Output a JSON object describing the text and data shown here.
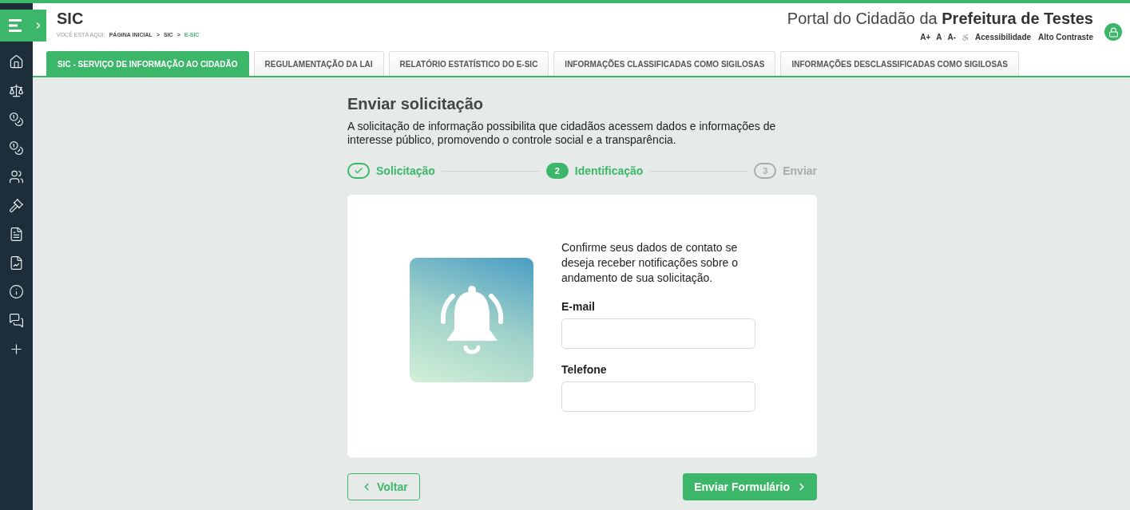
{
  "header": {
    "title": "SIC",
    "breadcrumb_label": "VOCÊ ESTÁ AQUI:",
    "breadcrumb": [
      {
        "label": "PÁGINA INICIAL",
        "selected": false
      },
      {
        "label": "SIC",
        "selected": false
      },
      {
        "label": "E-SIC",
        "selected": true
      }
    ],
    "breadcrumb_separator": ">",
    "portal_prefix": "Portal do Cidadão da",
    "portal_name": "Prefeitura de Testes",
    "accessibility": [
      "A+",
      "A",
      "A-"
    ],
    "accessibility_label": "Acessibilidade",
    "contrast_label": "Alto Contraste"
  },
  "tabs": [
    {
      "label": "SIC - SERVIÇO DE INFORMAÇÃO AO CIDADÃO",
      "selected": true
    },
    {
      "label": "REGULAMENTAÇÃO DA LAI",
      "selected": false
    },
    {
      "label": "RELATÓRIO ESTATÍSTICO DO E-SIC",
      "selected": false
    },
    {
      "label": "INFORMAÇÕES CLASSIFICADAS COMO SIGILOSAS",
      "selected": false
    },
    {
      "label": "INFORMAÇÕES DESCLASSIFICADAS COMO SIGILOSAS",
      "selected": false
    }
  ],
  "page": {
    "title": "Enviar solicitação",
    "description": "A solicitação de informação possibilita que cidadãos acessem dados e informações de interesse público, promovendo o controle social e a transparência."
  },
  "steps": [
    {
      "label": "Solicitação",
      "completed": true,
      "selected": false
    },
    {
      "number": "2",
      "label": "Identificação",
      "completed": false,
      "selected": true
    },
    {
      "number": "3",
      "label": "Enviar",
      "completed": false,
      "selected": false
    }
  ],
  "form": {
    "intro": "Confirme seus dados de contato se deseja receber notificações sobre o andamento de sua solicitação.",
    "fields": [
      {
        "label": "E-mail"
      },
      {
        "label": "Telefone"
      }
    ]
  },
  "buttons": {
    "back": "Voltar",
    "submit": "Enviar Formulário"
  }
}
